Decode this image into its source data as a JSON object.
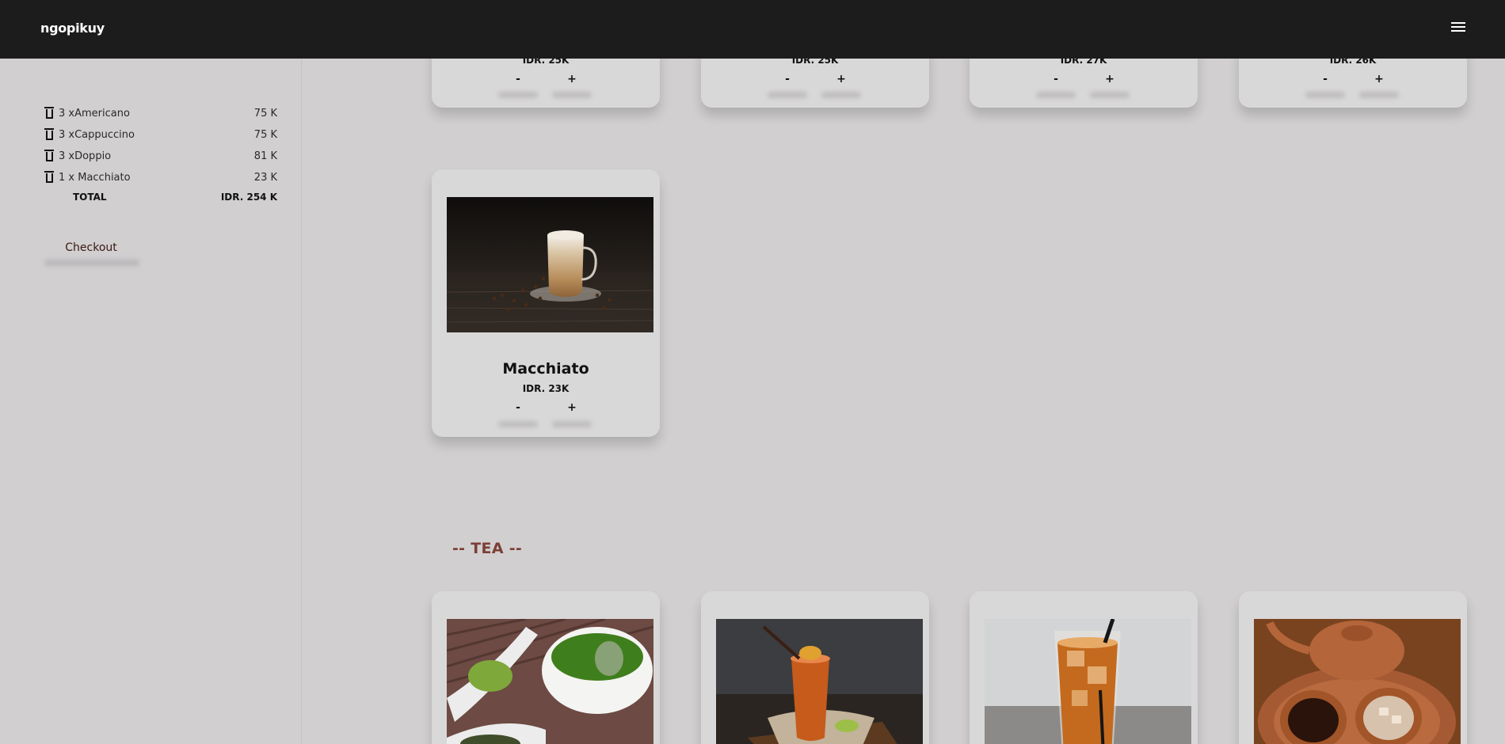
{
  "navbar": {
    "brand": "ngopikuy",
    "menu_icon": "hamburger-menu-icon"
  },
  "cart": {
    "items": [
      {
        "label": "3 xAmericano",
        "price": "75 K"
      },
      {
        "label": "3 xCappuccino",
        "price": "75 K"
      },
      {
        "label": "3 xDoppio",
        "price": "81 K"
      },
      {
        "label": "1 x Macchiato",
        "price": "23 K"
      }
    ],
    "total_label": "TOTAL",
    "total_value": "IDR. 254 K",
    "checkout_label": "Checkout"
  },
  "coffee_top_row": [
    {
      "price": "IDR. 25K",
      "minus": "-",
      "plus": "+"
    },
    {
      "price": "IDR. 25K",
      "minus": "-",
      "plus": "+"
    },
    {
      "price": "IDR. 27K",
      "minus": "-",
      "plus": "+"
    },
    {
      "price": "IDR. 26K",
      "minus": "-",
      "plus": "+"
    }
  ],
  "macchiato": {
    "title": "Macchiato",
    "price": "IDR. 23K",
    "minus": "-",
    "plus": "+"
  },
  "tea_section": {
    "title": "-- TEA --"
  },
  "colors": {
    "navbar_bg": "#1c1c1c",
    "page_bg": "#d1cfd0",
    "card_bg": "#d9d8d8",
    "section_title": "#7b3f35"
  }
}
